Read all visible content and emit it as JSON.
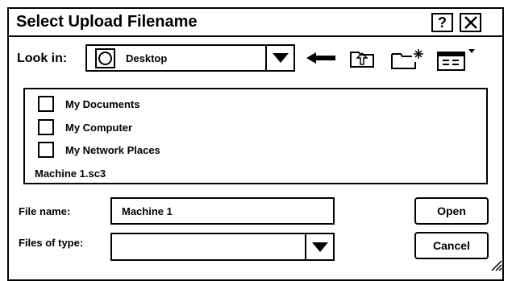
{
  "window": {
    "title": "Select Upload Filename",
    "help_label": "?",
    "close_glyph": "✕"
  },
  "look_in": {
    "label": "Look in:",
    "value": "Desktop"
  },
  "toolbar": {
    "back": "back-arrow-icon",
    "up": "up-folder-icon",
    "new_folder": "new-folder-icon",
    "view_menu": "view-menu-icon"
  },
  "files": {
    "items": [
      {
        "label": "My Documents"
      },
      {
        "label": "My Computer"
      },
      {
        "label": "My Network Places"
      },
      {
        "label": "Machine 1.sc3"
      }
    ]
  },
  "file_name": {
    "label": "File name:",
    "value": "Machine 1"
  },
  "file_type": {
    "label": "Files of type:",
    "value": ""
  },
  "buttons": {
    "open": "Open",
    "cancel": "Cancel"
  }
}
